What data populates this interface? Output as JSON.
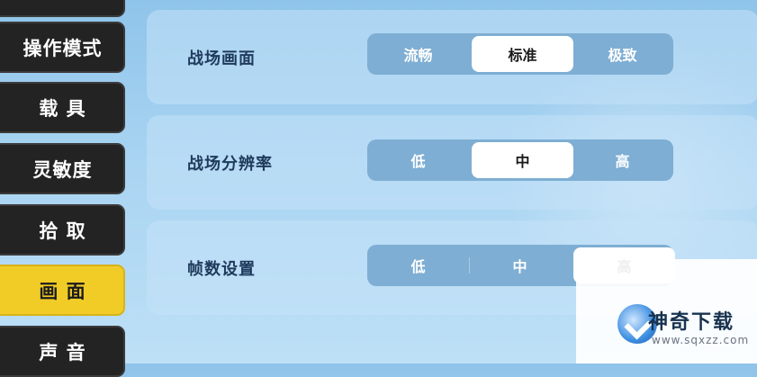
{
  "sidebar": {
    "items": [
      {
        "label": ""
      },
      {
        "label": "操作模式"
      },
      {
        "label": "载 具"
      },
      {
        "label": "灵敏度"
      },
      {
        "label": "拾 取"
      },
      {
        "label": "画 面"
      },
      {
        "label": "声 音"
      }
    ],
    "active_index": 5
  },
  "settings": [
    {
      "label": "战场画面",
      "options": [
        "流畅",
        "标准",
        "极致"
      ],
      "selected": "标准"
    },
    {
      "label": "战场分辨率",
      "options": [
        "低",
        "中",
        "高"
      ],
      "selected": "中"
    },
    {
      "label": "帧数设置",
      "options": [
        "低",
        "中",
        "高"
      ],
      "selected": "高"
    }
  ],
  "watermark": {
    "title": "神奇下载",
    "url": "www.sqxzz.com"
  },
  "colors": {
    "accent_active": "#f1cc27",
    "sidebar_bg": "#232323",
    "segment_bg": "#7eaed3"
  }
}
